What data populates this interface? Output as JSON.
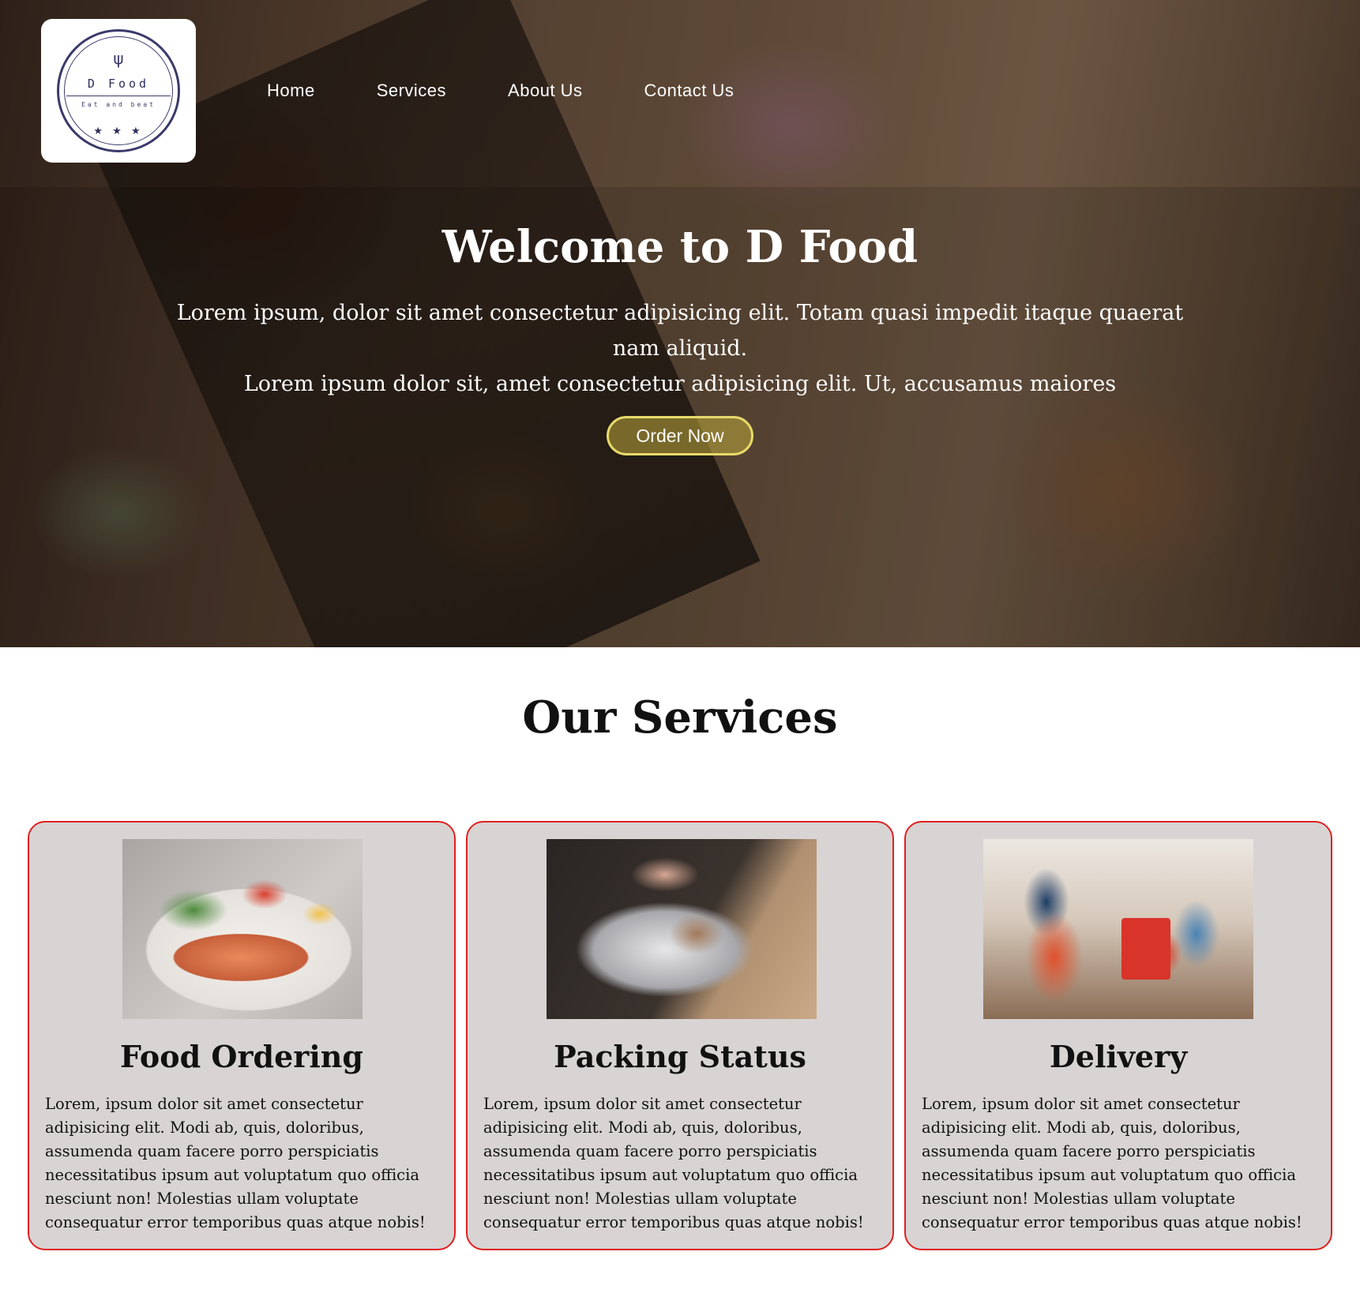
{
  "brand": {
    "name": "D Food",
    "tagline": "Eat and beat",
    "utensils_icon": "fork-knife-icon",
    "stars": "★ ★ ★"
  },
  "nav": {
    "items": [
      "Home",
      "Services",
      "About Us",
      "Contact Us"
    ]
  },
  "hero": {
    "title": "Welcome to D Food",
    "line1": "Lorem ipsum, dolor sit amet consectetur adipisicing elit. Totam quasi impedit itaque quaerat nam aliquid.",
    "line2": "Lorem ipsum dolor sit, amet consectetur adipisicing elit. Ut, accusamus maiores",
    "cta": "Order Now"
  },
  "services": {
    "title": "Our Services",
    "cards": [
      {
        "title": "Food Ordering",
        "text": "Lorem, ipsum dolor sit amet consectetur adipisicing elit. Modi ab, quis, doloribus, assumenda quam facere porro perspiciatis necessitatibus ipsum aut voluptatum quo officia nesciunt non! Molestias ullam voluptate consequatur error temporibus quas atque nobis!"
      },
      {
        "title": "Packing Status",
        "text": "Lorem, ipsum dolor sit amet consectetur adipisicing elit. Modi ab, quis, doloribus, assumenda quam facere porro perspiciatis necessitatibus ipsum aut voluptatum quo officia nesciunt non! Molestias ullam voluptate consequatur error temporibus quas atque nobis!"
      },
      {
        "title": "Delivery",
        "text": "Lorem, ipsum dolor sit amet consectetur adipisicing elit. Modi ab, quis, doloribus, assumenda quam facere porro perspiciatis necessitatibus ipsum aut voluptatum quo officia nesciunt non! Molestias ullam voluptate consequatur error temporibus quas atque nobis!"
      }
    ]
  },
  "colors": {
    "card_bg": "#d8d4d4",
    "card_border": "#e02020",
    "cta_border": "#e6d96a",
    "logo_ink": "#3b3a6b"
  }
}
